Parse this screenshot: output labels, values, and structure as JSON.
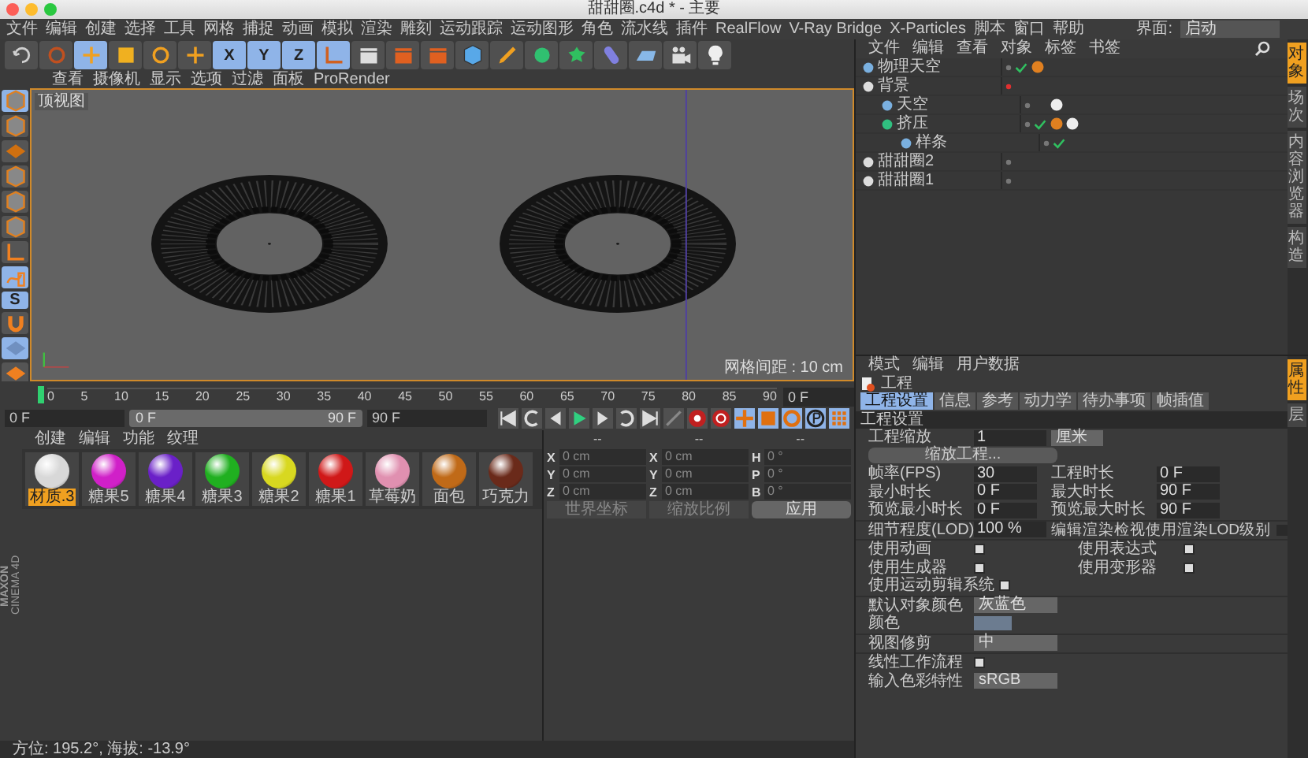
{
  "window": {
    "title": "甜甜圈.c4d * - 主要"
  },
  "menu_bar": {
    "items": [
      "文件",
      "编辑",
      "创建",
      "选择",
      "工具",
      "网格",
      "捕捉",
      "动画",
      "模拟",
      "渲染",
      "雕刻",
      "运动跟踪",
      "运动图形",
      "角色",
      "流水线",
      "插件",
      "RealFlow",
      "V-Ray Bridge",
      "X-Particles",
      "脚本",
      "窗口",
      "帮助"
    ],
    "layout_label": "界面:",
    "layout_value": "启动"
  },
  "toolbar": [
    {
      "kind": "undo",
      "selected": false
    },
    {
      "kind": "select",
      "selected": false
    },
    {
      "kind": "move",
      "selected": true
    },
    {
      "kind": "scale",
      "selected": false
    },
    {
      "kind": "rotate",
      "selected": false
    },
    {
      "kind": "transform",
      "selected": false
    },
    {
      "kind": "axis",
      "label": "X",
      "selected": true
    },
    {
      "kind": "axis",
      "label": "Y",
      "selected": true
    },
    {
      "kind": "axis",
      "label": "Z",
      "selected": true
    },
    {
      "kind": "coord",
      "selected": true
    },
    {
      "kind": "render-view",
      "selected": false
    },
    {
      "kind": "render",
      "selected": false
    },
    {
      "kind": "render-settings",
      "selected": false
    },
    {
      "kind": "cube",
      "selected": false
    },
    {
      "kind": "pen",
      "selected": false
    },
    {
      "kind": "subdivide",
      "selected": false
    },
    {
      "kind": "cloner",
      "selected": false
    },
    {
      "kind": "deformer",
      "selected": false
    },
    {
      "kind": "floor",
      "selected": false
    },
    {
      "kind": "camera",
      "selected": false
    },
    {
      "kind": "light",
      "selected": false
    }
  ],
  "tool_strip": [
    {
      "kind": "model",
      "selected": true
    },
    {
      "kind": "texture",
      "selected": false
    },
    {
      "kind": "workplane",
      "selected": false
    },
    {
      "kind": "points",
      "selected": false
    },
    {
      "kind": "edges",
      "selected": false
    },
    {
      "kind": "polygons",
      "selected": false
    },
    {
      "kind": "axis-mode",
      "selected": false
    },
    {
      "kind": "tweak",
      "selected": true
    },
    {
      "kind": "snap",
      "label": "S",
      "selected": true
    },
    {
      "kind": "magnet",
      "selected": false
    },
    {
      "kind": "floor-lock",
      "selected": true
    },
    {
      "kind": "floor-sync",
      "selected": false
    }
  ],
  "viewport": {
    "menu": [
      "查看",
      "摄像机",
      "显示",
      "选项",
      "过滤",
      "面板",
      "ProRender"
    ],
    "label": "顶视图",
    "grid_info": "网格间距 : 10 cm"
  },
  "timeline": {
    "ticks": [
      "0",
      "5",
      "10",
      "15",
      "20",
      "25",
      "30",
      "35",
      "40",
      "45",
      "50",
      "55",
      "60",
      "65",
      "70",
      "75",
      "80",
      "85",
      "90"
    ],
    "frame": "0 F"
  },
  "transport": {
    "level": 1,
    "start": "0 F",
    "range_start": "0 F",
    "range_end": "90 F",
    "end": "90 F"
  },
  "materials": {
    "menu": [
      "创建",
      "编辑",
      "功能",
      "纹理"
    ],
    "items": [
      {
        "name": "材质.3",
        "color": "#d8d8d8",
        "selected": true
      },
      {
        "name": "糖果5",
        "color": "#d020c8",
        "selected": false
      },
      {
        "name": "糖果4",
        "color": "#6a20c8",
        "selected": false
      },
      {
        "name": "糖果3",
        "color": "#20b020",
        "selected": false
      },
      {
        "name": "糖果2",
        "color": "#d8d820",
        "selected": false
      },
      {
        "name": "糖果1",
        "color": "#d01818",
        "selected": false
      },
      {
        "name": "草莓奶",
        "color": "#e090b0",
        "selected": false
      },
      {
        "name": "面包",
        "color": "#c06a18",
        "selected": false
      },
      {
        "name": "巧克力",
        "color": "#6a2a1a",
        "selected": false
      }
    ]
  },
  "coordinates": {
    "headers": [
      "--",
      "--",
      "--"
    ],
    "rows": [
      {
        "pos_axis": "X",
        "position": "0 cm",
        "size_axis": "X",
        "size": "0 cm",
        "rot_axis": "H",
        "rotation": "0 °"
      },
      {
        "pos_axis": "Y",
        "position": "0 cm",
        "size_axis": "Y",
        "size": "0 cm",
        "rot_axis": "P",
        "rotation": "0 °"
      },
      {
        "pos_axis": "Z",
        "position": "0 cm",
        "size_axis": "Z",
        "size": "0 cm",
        "rot_axis": "B",
        "rotation": "0 °"
      }
    ],
    "mode": "世界坐标",
    "scale_mode": "缩放比例",
    "apply": "应用"
  },
  "logo": [
    "MAXON",
    "CINEMA 4D"
  ],
  "status_bar": "方位: 195.2°, 海拔: -13.9°",
  "object_manager": {
    "menu": [
      "文件",
      "编辑",
      "查看",
      "对象",
      "标签",
      "书签"
    ],
    "objects": [
      {
        "name": "物理天空",
        "kind": "sky",
        "checked": true,
        "editor_hidden": false,
        "tags": [
          {
            "kind": "sky"
          }
        ]
      },
      {
        "name": "背景",
        "kind": "null",
        "checked": false,
        "editor_hidden": true,
        "children": [
          {
            "name": "天空",
            "kind": "sky",
            "checked": false,
            "editor_hidden": false,
            "tags": [
              {
                "kind": "material"
              }
            ]
          },
          {
            "name": "挤压",
            "kind": "extrude",
            "checked": true,
            "editor_hidden": false,
            "tags": [
              {
                "kind": "phong"
              },
              {
                "kind": "material"
              }
            ],
            "children": [
              {
                "name": "样条",
                "kind": "spline",
                "checked": true,
                "editor_hidden": false
              }
            ]
          }
        ]
      },
      {
        "name": "甜甜圈2",
        "kind": "null",
        "checked": false,
        "editor_hidden": false
      },
      {
        "name": "甜甜圈1",
        "kind": "null",
        "checked": false,
        "editor_hidden": false
      }
    ]
  },
  "side_tabs": [
    {
      "label": "对象",
      "selected": true
    },
    {
      "label": "场次",
      "selected": false
    },
    {
      "label": "内容浏览器",
      "selected": false
    },
    {
      "label": "构造",
      "selected": false
    }
  ],
  "attributes": {
    "menu": [
      "模式",
      "编辑",
      "用户数据"
    ],
    "heading": "工程",
    "tabs": [
      {
        "label": "工程设置",
        "selected": true
      },
      {
        "label": "信息",
        "selected": false
      },
      {
        "label": "参考",
        "selected": false
      },
      {
        "label": "动力学",
        "selected": false
      },
      {
        "label": "待办事项",
        "selected": false
      },
      {
        "label": "帧插值",
        "selected": false
      }
    ],
    "section": "工程设置",
    "scale": {
      "label": "工程缩放",
      "value": "1",
      "unit": "厘米"
    },
    "scale_button": "缩放工程...",
    "time_rows": [
      {
        "left": {
          "label": "帧率(FPS)",
          "value": "30"
        },
        "right": {
          "label": "工程时长",
          "value": "0 F"
        }
      },
      {
        "left": {
          "label": "最小时长",
          "value": "0 F"
        },
        "right": {
          "label": "最大时长",
          "value": "90 F"
        }
      },
      {
        "left": {
          "label": "预览最小时长",
          "value": "0 F"
        },
        "right": {
          "label": "预览最大时长",
          "value": "90 F"
        }
      }
    ],
    "lod": {
      "label": "细节程度(LOD)",
      "value": "100 %"
    },
    "lod_check": {
      "label": "编辑渲染检视使用渲染LOD级别",
      "checked": false
    },
    "checks": [
      {
        "label": "使用动画",
        "checked": true
      },
      {
        "label": "使用表达式",
        "checked": true
      },
      {
        "label": "使用生成器",
        "checked": true
      },
      {
        "label": "使用变形器",
        "checked": true
      },
      {
        "label": "使用运动剪辑系统",
        "checked": true
      }
    ],
    "default_color": {
      "label": "默认对象颜色",
      "value": "灰蓝色"
    },
    "color": {
      "label": "颜色",
      "color": "#6c7c90"
    },
    "clipping": {
      "label": "视图修剪",
      "value": "中"
    },
    "linear": {
      "label": "线性工作流程",
      "checked": true
    },
    "input_profile": {
      "label": "输入色彩特性",
      "value": "sRGB"
    }
  },
  "attribute_side_tabs": [
    {
      "label": "属性",
      "selected": true
    },
    {
      "label": "层",
      "selected": false
    }
  ]
}
